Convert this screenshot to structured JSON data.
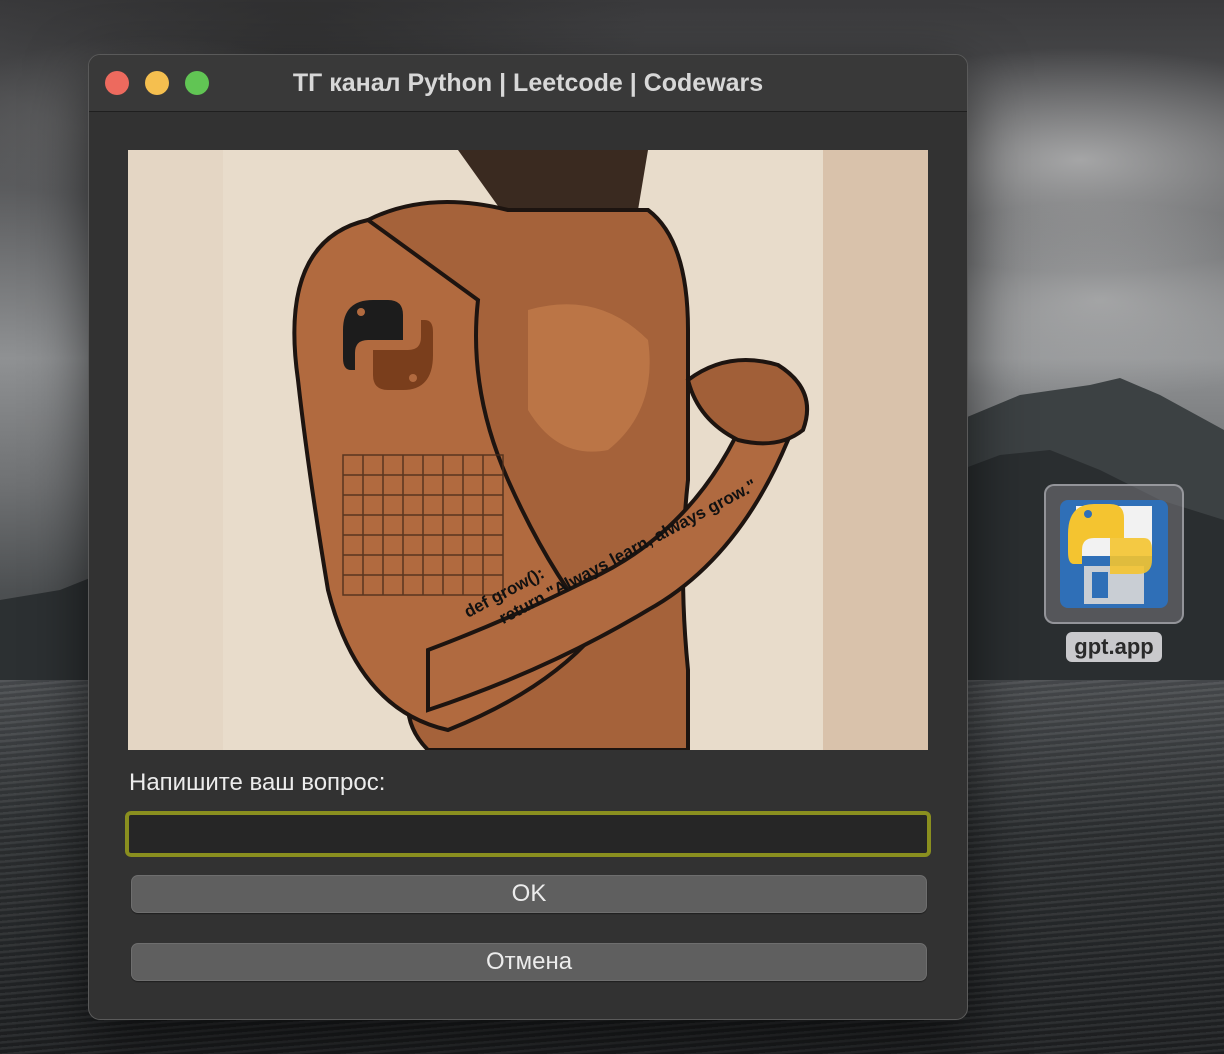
{
  "window": {
    "title": "ТГ канал Python | Leetcode | Codewars"
  },
  "image": {
    "code_line_1": "def grow():",
    "code_line_2": "return \"Always learn, always grow.\""
  },
  "form": {
    "prompt_label": "Напишите ваш вопрос:",
    "input_value": "",
    "ok_label": "OK",
    "cancel_label": "Отмена"
  },
  "desktop_icon": {
    "label": "gpt.app",
    "icon": "python-floppy-icon"
  },
  "colors": {
    "input_focus_border": "#8a8f1f",
    "window_bg": "#323232",
    "button_bg": "#5f5f5f"
  }
}
